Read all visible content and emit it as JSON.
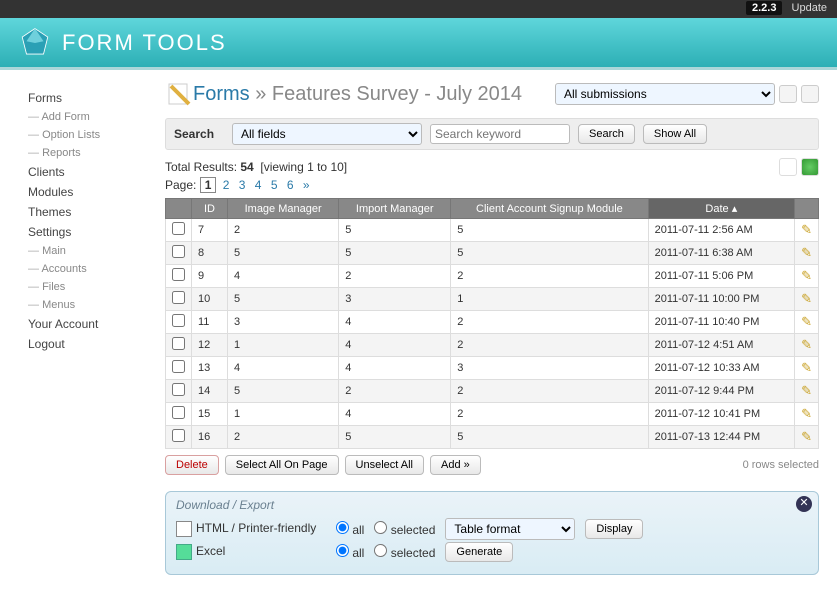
{
  "topbar": {
    "version": "2.2.3",
    "update": "Update"
  },
  "header": {
    "title": "FORM TOOLS"
  },
  "sidebar": {
    "forms": "Forms",
    "forms_sub": [
      "Add Form",
      "Option Lists",
      "Reports"
    ],
    "clients": "Clients",
    "modules": "Modules",
    "themes": "Themes",
    "settings": "Settings",
    "settings_sub": [
      "Main",
      "Accounts",
      "Files",
      "Menus"
    ],
    "account": "Your Account",
    "logout": "Logout"
  },
  "page": {
    "breadcrumb_forms": "Forms",
    "arrow": "»",
    "title": "Features Survey - July 2014",
    "submission_select": "All submissions"
  },
  "search": {
    "label": "Search",
    "field_select": "All fields",
    "placeholder": "Search keyword",
    "search_btn": "Search",
    "showall_btn": "Show All"
  },
  "results": {
    "total_label": "Total Results:",
    "total": "54",
    "viewing": "[viewing 1 to 10]"
  },
  "pager": {
    "label": "Page:",
    "current": "1",
    "pages": [
      "2",
      "3",
      "4",
      "5",
      "6"
    ],
    "next": "»"
  },
  "table": {
    "headers": [
      "",
      "ID",
      "Image Manager",
      "Import Manager",
      "Client Account Signup Module",
      "Date ▴",
      ""
    ],
    "rows": [
      {
        "id": "7",
        "im": "2",
        "imp": "5",
        "cas": "5",
        "date": "2011-07-11 2:56 AM"
      },
      {
        "id": "8",
        "im": "5",
        "imp": "5",
        "cas": "5",
        "date": "2011-07-11 6:38 AM"
      },
      {
        "id": "9",
        "im": "4",
        "imp": "2",
        "cas": "2",
        "date": "2011-07-11 5:06 PM"
      },
      {
        "id": "10",
        "im": "5",
        "imp": "3",
        "cas": "1",
        "date": "2011-07-11 10:00 PM"
      },
      {
        "id": "11",
        "im": "3",
        "imp": "4",
        "cas": "2",
        "date": "2011-07-11 10:40 PM"
      },
      {
        "id": "12",
        "im": "1",
        "imp": "4",
        "cas": "2",
        "date": "2011-07-12 4:51 AM"
      },
      {
        "id": "13",
        "im": "4",
        "imp": "4",
        "cas": "3",
        "date": "2011-07-12 10:33 AM"
      },
      {
        "id": "14",
        "im": "5",
        "imp": "2",
        "cas": "2",
        "date": "2011-07-12 9:44 PM"
      },
      {
        "id": "15",
        "im": "1",
        "imp": "4",
        "cas": "2",
        "date": "2011-07-12 10:41 PM"
      },
      {
        "id": "16",
        "im": "2",
        "imp": "5",
        "cas": "5",
        "date": "2011-07-13 12:44 PM"
      }
    ]
  },
  "actions": {
    "delete": "Delete",
    "select_all": "Select All On Page",
    "unselect": "Unselect All",
    "add": "Add »",
    "rows_selected": "0 rows selected"
  },
  "export": {
    "title": "Download / Export",
    "rows": [
      {
        "name": "HTML / Printer-friendly",
        "all": "all",
        "selected": "selected",
        "format": "Table format",
        "btn": "Display"
      },
      {
        "name": "Excel",
        "all": "all",
        "selected": "selected",
        "btn": "Generate"
      }
    ]
  }
}
